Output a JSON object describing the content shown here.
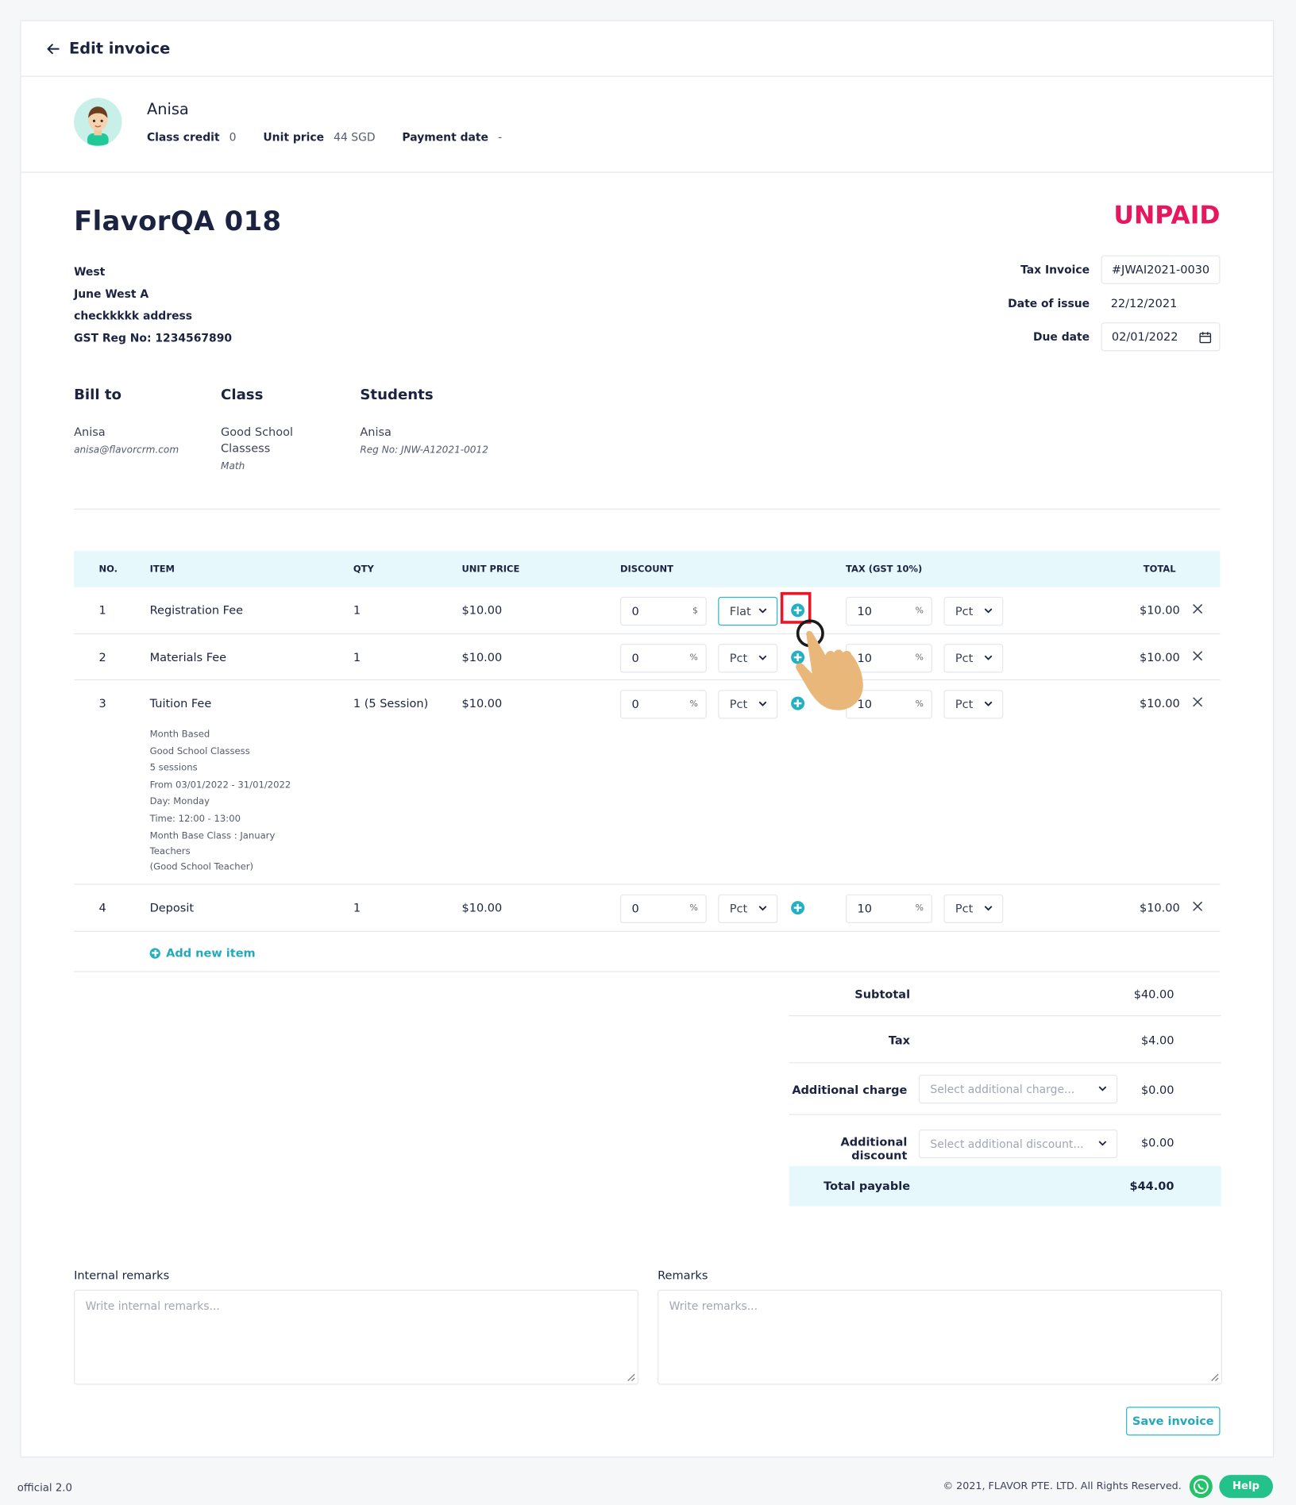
{
  "header": {
    "title": "Edit invoice"
  },
  "student": {
    "name": "Anisa",
    "class_credit_label": "Class credit",
    "class_credit": "0",
    "unit_price_label": "Unit price",
    "unit_price": "44 SGD",
    "payment_date_label": "Payment date",
    "payment_date": "-"
  },
  "invoice": {
    "title": "FlavorQA 018",
    "status": "UNPAID",
    "status_color": "#e8175d",
    "company": [
      "West",
      "June West A",
      "checkkkkk address",
      "GST Reg No: 1234567890"
    ],
    "tax_invoice_label": "Tax Invoice",
    "tax_invoice": "#JWAI2021-0030",
    "date_issue_label": "Date of issue",
    "date_issue": "22/12/2021",
    "due_date_label": "Due date",
    "due_date": "02/01/2022"
  },
  "bill_to": {
    "heading": "Bill to",
    "name": "Anisa",
    "email": "anisa@flavorcrm.com"
  },
  "class_info": {
    "heading": "Class",
    "name": "Good School Classess",
    "subject": "Math"
  },
  "students": {
    "heading": "Students",
    "name": "Anisa",
    "reg": "Reg No: JNW-A12021-0012"
  },
  "table": {
    "headers": {
      "no": "NO.",
      "item": "ITEM",
      "qty": "QTY",
      "unit_price": "UNIT PRICE",
      "discount": "DISCOUNT",
      "tax": "TAX (GST 10%)",
      "total": "TOTAL"
    },
    "rows": [
      {
        "no": "1",
        "item": "Registration Fee",
        "qty": "1",
        "unit_price": "$10.00",
        "discount": "0",
        "discount_unit": "$",
        "discount_type": "Flat",
        "tax": "10",
        "tax_unit": "%",
        "tax_type": "Pct",
        "total": "$10.00"
      },
      {
        "no": "2",
        "item": "Materials Fee",
        "qty": "1",
        "unit_price": "$10.00",
        "discount": "0",
        "discount_unit": "%",
        "discount_type": "Pct",
        "tax": "10",
        "tax_unit": "%",
        "tax_type": "Pct",
        "total": "$10.00"
      },
      {
        "no": "3",
        "item": "Tuition Fee",
        "qty": "1 (5 Session)",
        "unit_price": "$10.00",
        "discount": "0",
        "discount_unit": "%",
        "discount_type": "Pct",
        "tax": "10",
        "tax_unit": "%",
        "tax_type": "Pct",
        "total": "$10.00",
        "details": [
          "Month Based",
          "Good School Classess",
          "5 sessions",
          "From 03/01/2022 - 31/01/2022",
          "Day: Monday",
          "Time: 12:00 - 13:00",
          "Month Base Class : January",
          "Teachers",
          "(Good School Teacher)"
        ]
      },
      {
        "no": "4",
        "item": "Deposit",
        "qty": "1",
        "unit_price": "$10.00",
        "discount": "0",
        "discount_unit": "%",
        "discount_type": "Pct",
        "tax": "10",
        "tax_unit": "%",
        "tax_type": "Pct",
        "total": "$10.00"
      }
    ],
    "add_item": "Add new item"
  },
  "summary": {
    "subtotal_label": "Subtotal",
    "subtotal": "$40.00",
    "tax_label": "Tax",
    "tax": "$4.00",
    "charge_label": "Additional charge",
    "charge_placeholder": "Select additional charge...",
    "charge": "$0.00",
    "discount_label": "Additional discount",
    "discount_placeholder": "Select additional discount...",
    "discount": "$0.00",
    "total_label": "Total payable",
    "total": "$44.00"
  },
  "remarks": {
    "internal_label": "Internal remarks",
    "internal_placeholder": "Write internal remarks...",
    "remarks_label": "Remarks",
    "remarks_placeholder": "Write remarks..."
  },
  "save_label": "Save invoice",
  "footer": {
    "version": "official 2.0",
    "copyright": "© 2021, FLAVOR PTE. LTD. All Rights Reserved.",
    "help": "Help"
  },
  "colors": {
    "accent": "#23b0c4",
    "header_bg": "#e6f8fc",
    "highlight": "#e8172a"
  }
}
